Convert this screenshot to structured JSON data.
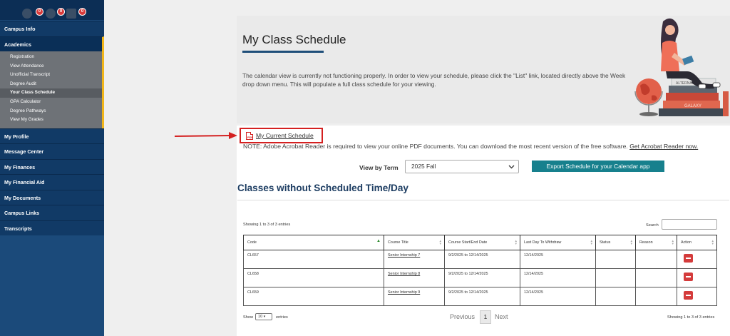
{
  "sidebar": {
    "top_icons": [
      "user-icon",
      "bell-icon",
      "calendar-icon"
    ],
    "top_badges": [
      "0",
      "0",
      "0"
    ],
    "items_before": [
      {
        "label": "Campus Info"
      }
    ],
    "academics": {
      "label": "Academics",
      "sub_items": [
        {
          "label": "Registration"
        },
        {
          "label": "View Attendance"
        },
        {
          "label": "Unofficial Transcript"
        },
        {
          "label": "Degree Audit"
        },
        {
          "label": "Your Class Schedule"
        },
        {
          "label": "GPA Calculator"
        },
        {
          "label": "Degree Pathways"
        },
        {
          "label": "View My Grades"
        }
      ]
    },
    "items_after": [
      {
        "label": "My Profile"
      },
      {
        "label": "Message Center"
      },
      {
        "label": "My Finances"
      },
      {
        "label": "My Financial Aid"
      },
      {
        "label": "My Documents"
      },
      {
        "label": "Campus Links"
      },
      {
        "label": "Transcripts"
      }
    ]
  },
  "banner": {
    "title": "My Class Schedule",
    "message": "The calendar view is currently not functioning properly. In order to view your schedule, please click the \"List\" link, located directly above the Week drop down menu. This will populate a full class schedule for your viewing.",
    "book_labels": [
      "ALTERNATIVE",
      "GALAXY"
    ]
  },
  "content": {
    "schedule_link": "My Current Schedule",
    "pdf_icon_text": "PDF",
    "note": "NOTE: Adobe Acrobat Reader is required to view your online PDF documents. You can download the most recent version of the free software.",
    "acrobat_link": "Get Acrobat Reader now.",
    "term_label": "View by Term",
    "term_value": "2025 Fall",
    "export_button": "Export Schedule for your Calendar app",
    "section_title": "Classes without Scheduled Time/Day"
  },
  "table": {
    "showing_top": "Showing 1 to 3 of 3 entries",
    "search_label": "Search",
    "columns": [
      "Code",
      "Course Title",
      "Course Start/End Date",
      "Last Day To Withdraw",
      "Status",
      "Reason",
      "Action"
    ],
    "rows": [
      {
        "code": "CL657",
        "title": "Senior Internship 7",
        "dates": "9/2/2025 to 12/14/2025",
        "withdraw": "12/14/2025",
        "status": "",
        "reason": ""
      },
      {
        "code": "CL658",
        "title": "Senior Internship 8",
        "dates": "9/2/2025 to 12/14/2025",
        "withdraw": "12/14/2025",
        "status": "",
        "reason": ""
      },
      {
        "code": "CL659",
        "title": "Senior Internship 9",
        "dates": "9/2/2025 to 12/14/2025",
        "withdraw": "12/14/2025",
        "status": "",
        "reason": ""
      }
    ],
    "show_label": "Show",
    "entries_value": "10",
    "entries_label": "entries",
    "previous": "Previous",
    "page": "1",
    "next": "Next",
    "showing_bottom": "Showing 1 to 3 of 3 entries"
  },
  "colors": {
    "sidebar": "#1b4a7a",
    "accent": "#f0b51a",
    "export_button": "#17808d",
    "delete_button": "#d43b3b",
    "highlight": "#d42020"
  }
}
